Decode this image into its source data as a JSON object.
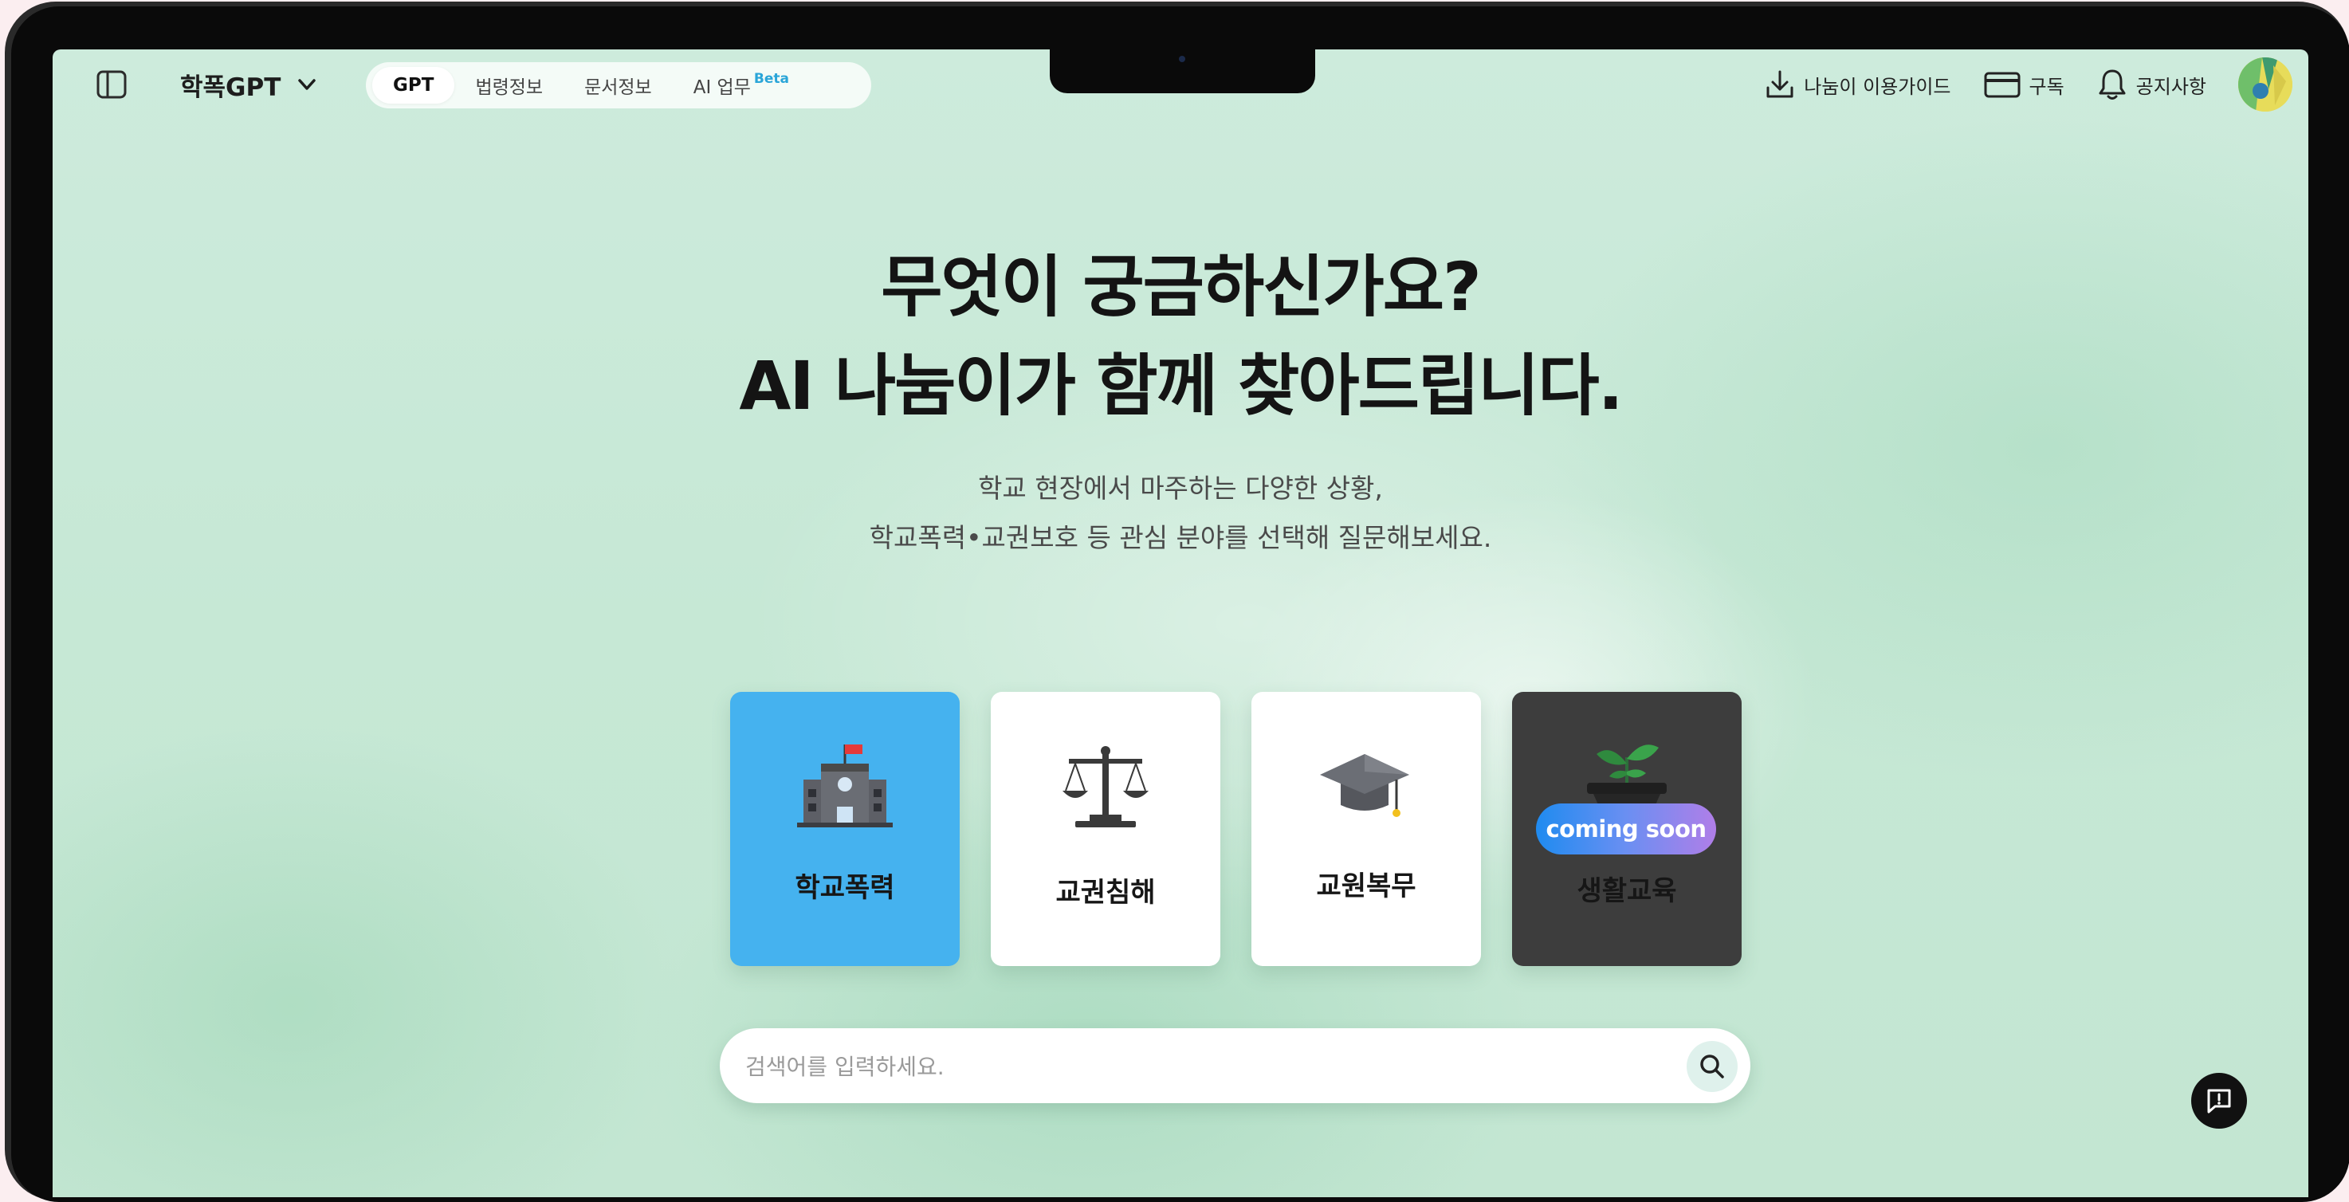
{
  "topbar": {
    "brand": "학폭GPT",
    "tabs": [
      {
        "label": "GPT"
      },
      {
        "label": "법령정보"
      },
      {
        "label": "문서정보"
      },
      {
        "label": "AI 업무",
        "badge": "Beta"
      }
    ],
    "guide_label": "나눔이 이용가이드",
    "subscribe_label": "구독",
    "notice_label": "공지사항"
  },
  "hero": {
    "title_line1": "무엇이 궁금하신가요?",
    "title_line2": "AI 나눔이가 함께 찾아드립니다.",
    "subtitle_line1": "학교 현장에서 마주하는 다양한 상황,",
    "subtitle_line2": "학교폭력•교권보호 등 관심 분야를 선택해 질문해보세요."
  },
  "cards": [
    {
      "label": "학교폭력",
      "icon": "school-building-icon",
      "selected": true,
      "bg": "#45b2ef"
    },
    {
      "label": "교권침해",
      "icon": "scales-icon",
      "selected": false,
      "bg": "#ffffff"
    },
    {
      "label": "교원복무",
      "icon": "graduation-cap-icon",
      "selected": false,
      "bg": "#ffffff"
    },
    {
      "label": "생활교육",
      "icon": "sprout-plant-icon",
      "selected": false,
      "bg": "#3d3d3d",
      "badge": "coming soon"
    }
  ],
  "search": {
    "placeholder": "검색어를 입력하세요.",
    "value": ""
  },
  "colors": {
    "accent": "#45b2ef",
    "beta": "#2aa5d8",
    "background": "#c6e8d5"
  }
}
